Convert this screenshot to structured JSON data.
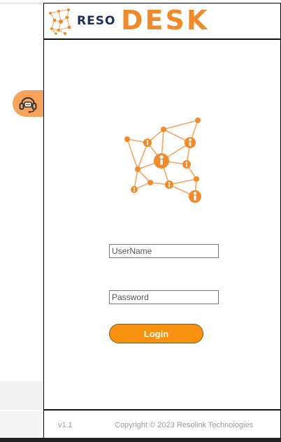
{
  "brand": {
    "logo_reso": "RESO",
    "logo_desk": "DESK",
    "accent_color": "#f7910f",
    "navy_color": "#1f2e5a"
  },
  "support": {
    "icon": "headset-chat-icon"
  },
  "hero": {
    "icon": "people-network-icon"
  },
  "login_form": {
    "username_placeholder": "UserName",
    "username_value": "",
    "password_placeholder": "Password",
    "password_value": "",
    "login_label": "Login"
  },
  "footer": {
    "version": "v1.1",
    "copyright": "Copyright © 2023 Resolink Technologies"
  }
}
